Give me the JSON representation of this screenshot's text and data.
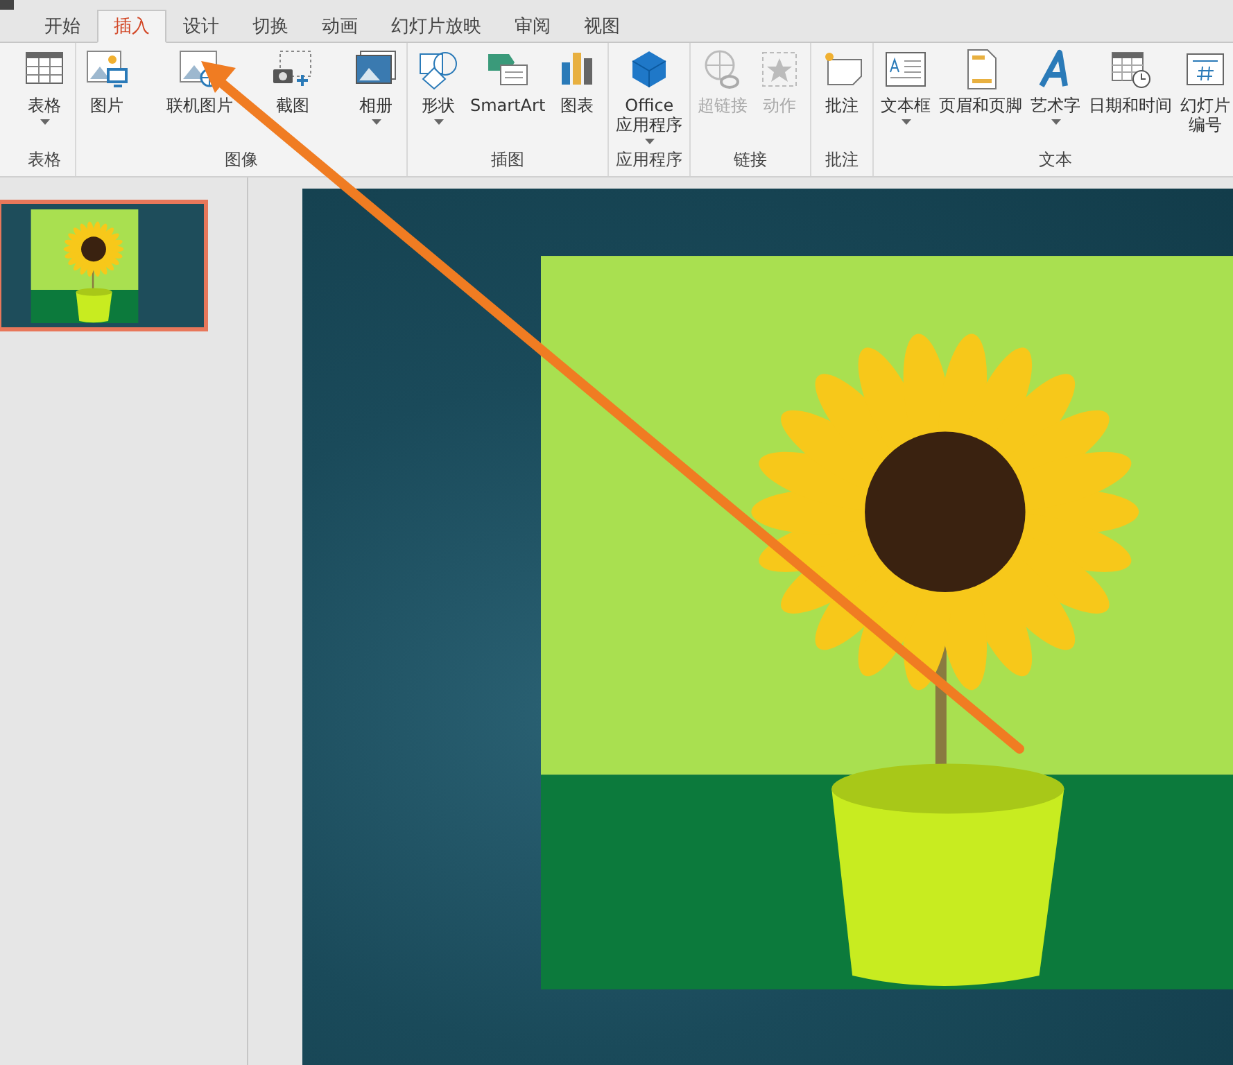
{
  "tabs": [
    {
      "label": "开始",
      "selected": false
    },
    {
      "label": "插入",
      "selected": true
    },
    {
      "label": "设计",
      "selected": false
    },
    {
      "label": "切换",
      "selected": false
    },
    {
      "label": "动画",
      "selected": false
    },
    {
      "label": "幻灯片放映",
      "selected": false
    },
    {
      "label": "审阅",
      "selected": false
    },
    {
      "label": "视图",
      "selected": false
    }
  ],
  "ribbon_groups": [
    {
      "label": "表格",
      "items": [
        {
          "lines": [
            "表格"
          ],
          "kind": "table",
          "dropdown": true,
          "disabled": false
        }
      ]
    },
    {
      "label": "图像",
      "items": [
        {
          "lines": [
            "图片"
          ],
          "kind": "picture",
          "dropdown": false,
          "disabled": false
        },
        {
          "lines": [
            "联机图片"
          ],
          "kind": "online-picture",
          "dropdown": false,
          "disabled": false
        },
        {
          "lines": [
            "截图"
          ],
          "kind": "screenshot",
          "dropdown": false,
          "disabled": false
        },
        {
          "lines": [
            "相册"
          ],
          "kind": "album",
          "dropdown": true,
          "disabled": false
        }
      ]
    },
    {
      "label": "插图",
      "items": [
        {
          "lines": [
            "形状"
          ],
          "kind": "shapes",
          "dropdown": true,
          "disabled": false
        },
        {
          "lines": [
            "SmartArt"
          ],
          "kind": "smartart",
          "dropdown": false,
          "disabled": false
        },
        {
          "lines": [
            "图表"
          ],
          "kind": "chart",
          "dropdown": false,
          "disabled": false
        }
      ]
    },
    {
      "label": "应用程序",
      "items": [
        {
          "lines": [
            "Office",
            "应用程序"
          ],
          "kind": "office",
          "dropdown": true,
          "disabled": false
        }
      ]
    },
    {
      "label": "链接",
      "items": [
        {
          "lines": [
            "超链接"
          ],
          "kind": "hyperlink",
          "dropdown": false,
          "disabled": true
        },
        {
          "lines": [
            "动作"
          ],
          "kind": "action",
          "dropdown": false,
          "disabled": true
        }
      ]
    },
    {
      "label": "批注",
      "items": [
        {
          "lines": [
            "批注"
          ],
          "kind": "comment",
          "dropdown": false,
          "disabled": false
        }
      ]
    },
    {
      "label": "文本",
      "items": [
        {
          "lines": [
            "文本框"
          ],
          "kind": "textbox",
          "dropdown": true,
          "disabled": false
        },
        {
          "lines": [
            "页眉和页脚"
          ],
          "kind": "header-footer",
          "dropdown": false,
          "disabled": false
        },
        {
          "lines": [
            "艺术字"
          ],
          "kind": "wordart",
          "dropdown": true,
          "disabled": false
        },
        {
          "lines": [
            "日期和时间"
          ],
          "kind": "datetime",
          "dropdown": false,
          "disabled": false
        },
        {
          "lines": [
            "幻灯片",
            "编号"
          ],
          "kind": "slide-number",
          "dropdown": false,
          "disabled": false
        }
      ]
    }
  ],
  "thumbnails": [
    {
      "selected": true
    }
  ]
}
